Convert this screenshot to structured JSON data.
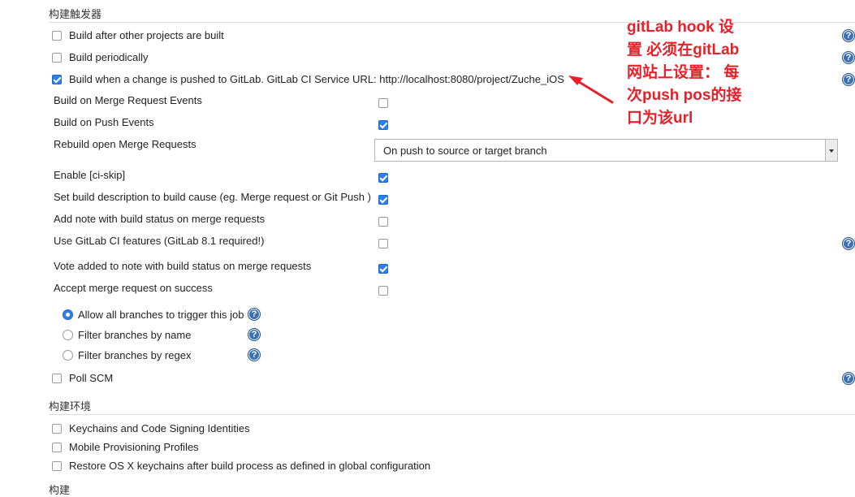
{
  "triggers": {
    "title": "构建触发器",
    "build_after_other": {
      "label": "Build after other projects are built",
      "checked": false
    },
    "build_periodically": {
      "label": "Build periodically",
      "checked": false
    },
    "build_on_gitlab_push": {
      "label": "Build when a change is pushed to GitLab. GitLab CI Service URL: http://localhost:8080/project/Zuche_iOS",
      "checked": true
    },
    "options": [
      {
        "label": "Build on Merge Request Events",
        "checked": false
      },
      {
        "label": "Build on Push Events",
        "checked": true
      },
      {
        "label": "Rebuild open Merge Requests"
      },
      {
        "label": "Enable [ci-skip]",
        "checked": true
      },
      {
        "label": "Set build description to build cause (eg. Merge request or Git Push )",
        "checked": true
      },
      {
        "label": "Add note with build status on merge requests",
        "checked": false
      },
      {
        "label": "Use GitLab CI features (GitLab 8.1 required!)",
        "checked": false
      },
      {
        "label": "Vote added to note with build status on merge requests",
        "checked": true
      },
      {
        "label": "Accept merge request on success",
        "checked": false
      }
    ],
    "rebuild_select": {
      "value": "On push to source or target branch"
    },
    "branch_filter": [
      {
        "label": "Allow all branches to trigger this job",
        "selected": true
      },
      {
        "label": "Filter branches by name",
        "selected": false
      },
      {
        "label": "Filter branches by regex",
        "selected": false
      }
    ],
    "poll_scm": {
      "label": "Poll SCM",
      "checked": false
    }
  },
  "environment": {
    "title": "构建环境",
    "items": [
      {
        "label": "Keychains and Code Signing Identities",
        "checked": false
      },
      {
        "label": "Mobile Provisioning Profiles",
        "checked": false
      },
      {
        "label": "Restore OS X keychains after build process as defined in global configuration",
        "checked": false
      }
    ]
  },
  "build": {
    "title": "构建"
  },
  "help_icon": {
    "glyph": "?",
    "icon": "help-icon"
  },
  "annotation": {
    "text": "gitLab hook 设置 必须在gitLab 网站上设置： 每次push pos的接口为该url",
    "color": "#e8202a"
  }
}
